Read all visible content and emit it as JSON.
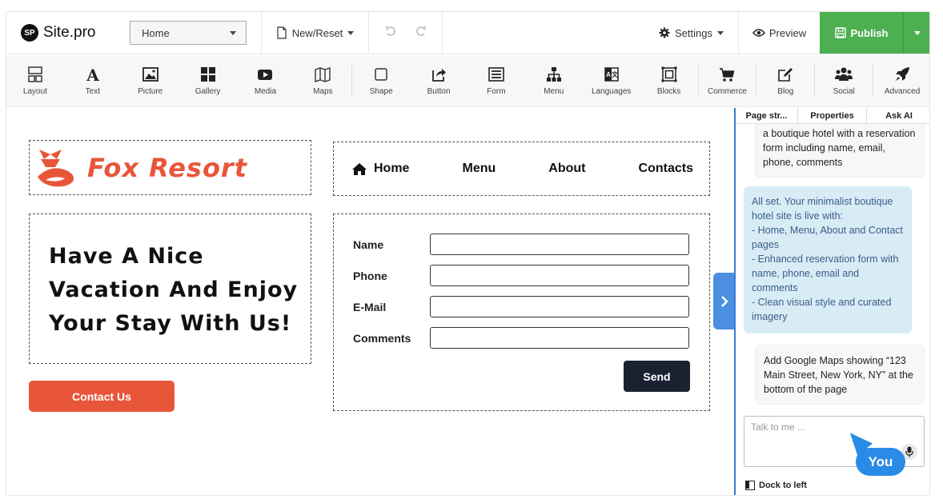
{
  "brand": {
    "badge": "SP",
    "name": "Site.pro"
  },
  "header": {
    "page_select_value": "Home",
    "new_reset_label": "New/Reset",
    "settings_label": "Settings",
    "preview_label": "Preview",
    "publish_label": "Publish"
  },
  "toolbar": {
    "items": [
      {
        "label": "Layout",
        "icon": "layout-icon"
      },
      {
        "label": "Text",
        "icon": "text-icon"
      },
      {
        "label": "Picture",
        "icon": "picture-icon"
      },
      {
        "label": "Gallery",
        "icon": "gallery-icon"
      },
      {
        "label": "Media",
        "icon": "media-icon"
      },
      {
        "label": "Maps",
        "icon": "maps-icon"
      },
      {
        "label": "Shape",
        "icon": "shape-icon"
      },
      {
        "label": "Button",
        "icon": "button-icon"
      },
      {
        "label": "Form",
        "icon": "form-icon"
      },
      {
        "label": "Menu",
        "icon": "menu-icon"
      },
      {
        "label": "Languages",
        "icon": "languages-icon"
      },
      {
        "label": "Blocks",
        "icon": "blocks-icon"
      },
      {
        "label": "Commerce",
        "icon": "commerce-icon"
      },
      {
        "label": "Blog",
        "icon": "blog-icon"
      },
      {
        "label": "Social",
        "icon": "social-icon"
      },
      {
        "label": "Advanced",
        "icon": "advanced-icon"
      }
    ]
  },
  "site": {
    "brand_name": "Fox Resort",
    "nav": [
      "Home",
      "Menu",
      "About",
      "Contacts"
    ],
    "hero_lines": [
      "Have A Nice",
      "Vacation And Enjoy",
      "Your Stay With Us!"
    ],
    "contact_button": "Contact Us",
    "form": {
      "fields": [
        "Name",
        "Phone",
        "E-Mail",
        "Comments"
      ],
      "submit": "Send"
    },
    "brand_color": "#e8563a"
  },
  "panel": {
    "tabs": [
      "Page str...",
      "Properties",
      "Ask AI"
    ],
    "messages": [
      {
        "role": "user",
        "text": "a boutique hotel with a reservation form including name, email, phone, comments"
      },
      {
        "role": "ai",
        "text": "All set. Your minimalist boutique hotel site is live with:\n- Home, Menu, About and Contact pages\n- Enhanced reservation form with name, phone, email and comments\n- Clean visual style and curated imagery"
      },
      {
        "role": "user",
        "text": "Add Google Maps showing “123 Main Street, New York, NY” at the bottom of the page"
      }
    ],
    "input_placeholder": "Talk to me ...",
    "dock_label": "Dock to left"
  },
  "cursor_label": "You",
  "colors": {
    "publish": "#4caf50",
    "panel_border": "#3a7bd5",
    "ai_bubble": "#d8ecf6",
    "cursor": "#2a8be6"
  }
}
